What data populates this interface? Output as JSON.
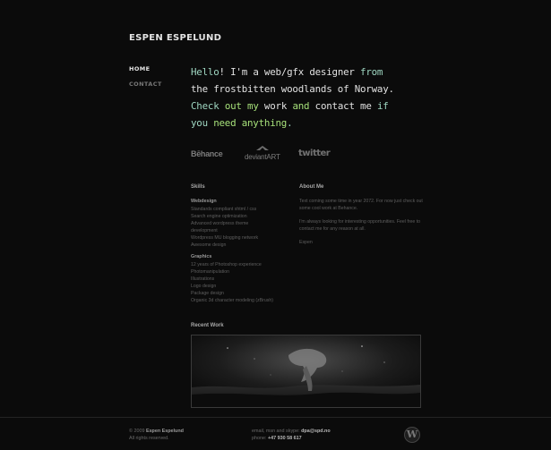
{
  "header": {
    "site_title": "ESPEN ESPELUND"
  },
  "nav": {
    "items": [
      {
        "label": "HOME",
        "active": true
      },
      {
        "label": "CONTACT",
        "active": false
      }
    ]
  },
  "intro": {
    "p1": "Hello",
    "p2": "! I'm a ",
    "p3": "web/gfx designer",
    "p4": " from",
    "p5": "the frostbitten woodlands of Norway.",
    "p6": "Check ",
    "p7": "out my",
    "p8": " work ",
    "p9": "and",
    "p10": " contact me ",
    "p11": "if",
    "p12": "you ",
    "p13": "need anything",
    "p14": "."
  },
  "social": {
    "behance": "Bēhance",
    "deviantart": "deviantART",
    "twitter": "twitter"
  },
  "skills": {
    "heading": "Skills",
    "webdesign_heading": "Webdesign",
    "webdesign": [
      "Standards compliant xhtml / css",
      "Search engine optimization",
      "Advanced wordpress theme",
      "development",
      "Wordpress MU blogging network",
      "Awesome design"
    ],
    "graphics_heading": "Graphics",
    "graphics": [
      "12 years of Photoshop experience",
      "Photomanipulation",
      "Illustrations",
      "Logo design",
      "Package design",
      "Organic 3d character modeling (zBrush)"
    ]
  },
  "about": {
    "heading": "About Me",
    "paragraphs": [
      "Text coming some time in year 2072. For now just check out some cool work at Behance.",
      "I'm always looking for interesting opportunities. Feel free to contact me for any reason at all.",
      "Espen"
    ]
  },
  "recent": {
    "heading": "Recent Work"
  },
  "footer": {
    "copyright_prefix": "© 2009 ",
    "copyright_name": "Espen Espelund",
    "rights": "All rights reserved.",
    "contact_line_prefix": "email, msn and skype: ",
    "email": "dpa@spd.no",
    "phone_prefix": "phone: ",
    "phone": "+47 930 58 617",
    "wp_icon": "wordpress-icon"
  }
}
